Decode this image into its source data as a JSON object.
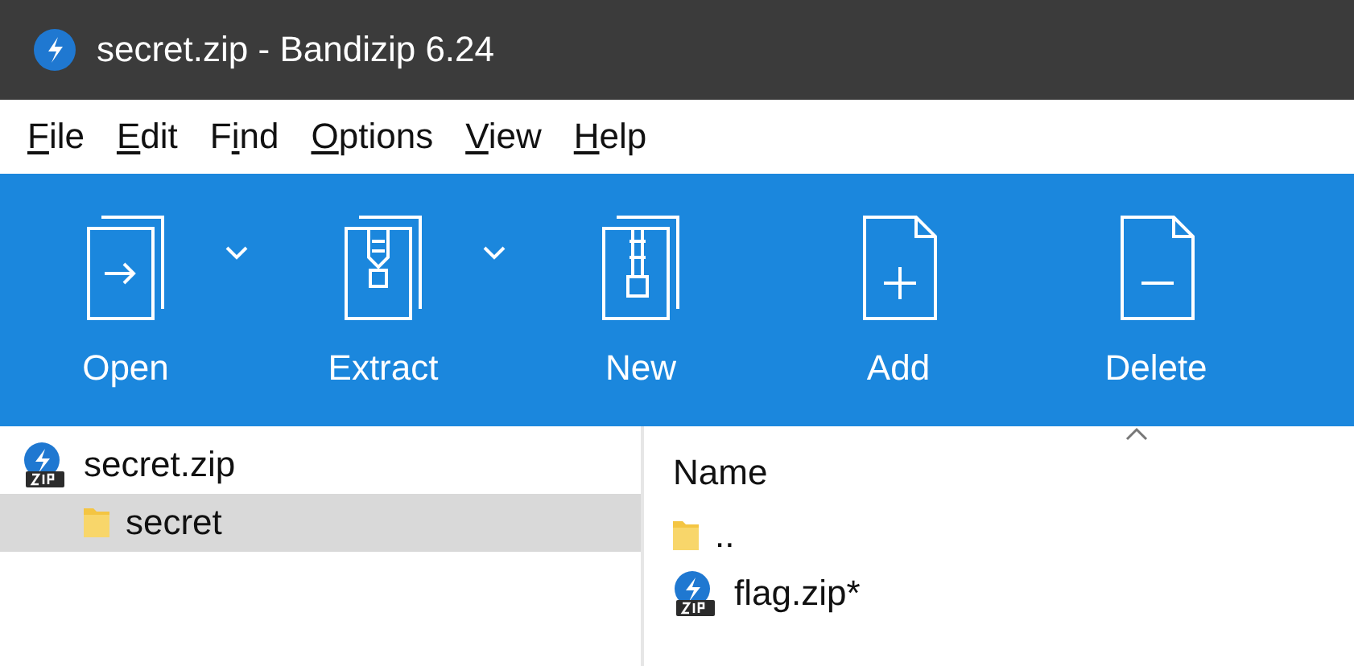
{
  "window": {
    "title": "secret.zip - Bandizip 6.24"
  },
  "menu": [
    {
      "accel": "F",
      "rest": "ile"
    },
    {
      "accel": "E",
      "rest": "dit"
    },
    {
      "pre": "F",
      "accel": "i",
      "rest": "nd"
    },
    {
      "accel": "O",
      "rest": "ptions"
    },
    {
      "accel": "V",
      "rest": "iew"
    },
    {
      "accel": "H",
      "rest": "elp"
    }
  ],
  "toolbar": [
    {
      "kind": "open",
      "label": "Open",
      "dropdown": true
    },
    {
      "kind": "extract",
      "label": "Extract",
      "dropdown": true
    },
    {
      "kind": "new",
      "label": "New",
      "dropdown": false
    },
    {
      "kind": "add",
      "label": "Add",
      "dropdown": false
    },
    {
      "kind": "delete",
      "label": "Delete",
      "dropdown": false
    }
  ],
  "tree": [
    {
      "kind": "zip",
      "label": "secret.zip",
      "selected": false,
      "children": [
        {
          "kind": "folder",
          "label": "secret",
          "selected": true
        }
      ]
    }
  ],
  "files": {
    "column": "Name",
    "rows": [
      {
        "kind": "folder",
        "name": ".."
      },
      {
        "kind": "zip",
        "name": "flag.zip*"
      }
    ]
  }
}
